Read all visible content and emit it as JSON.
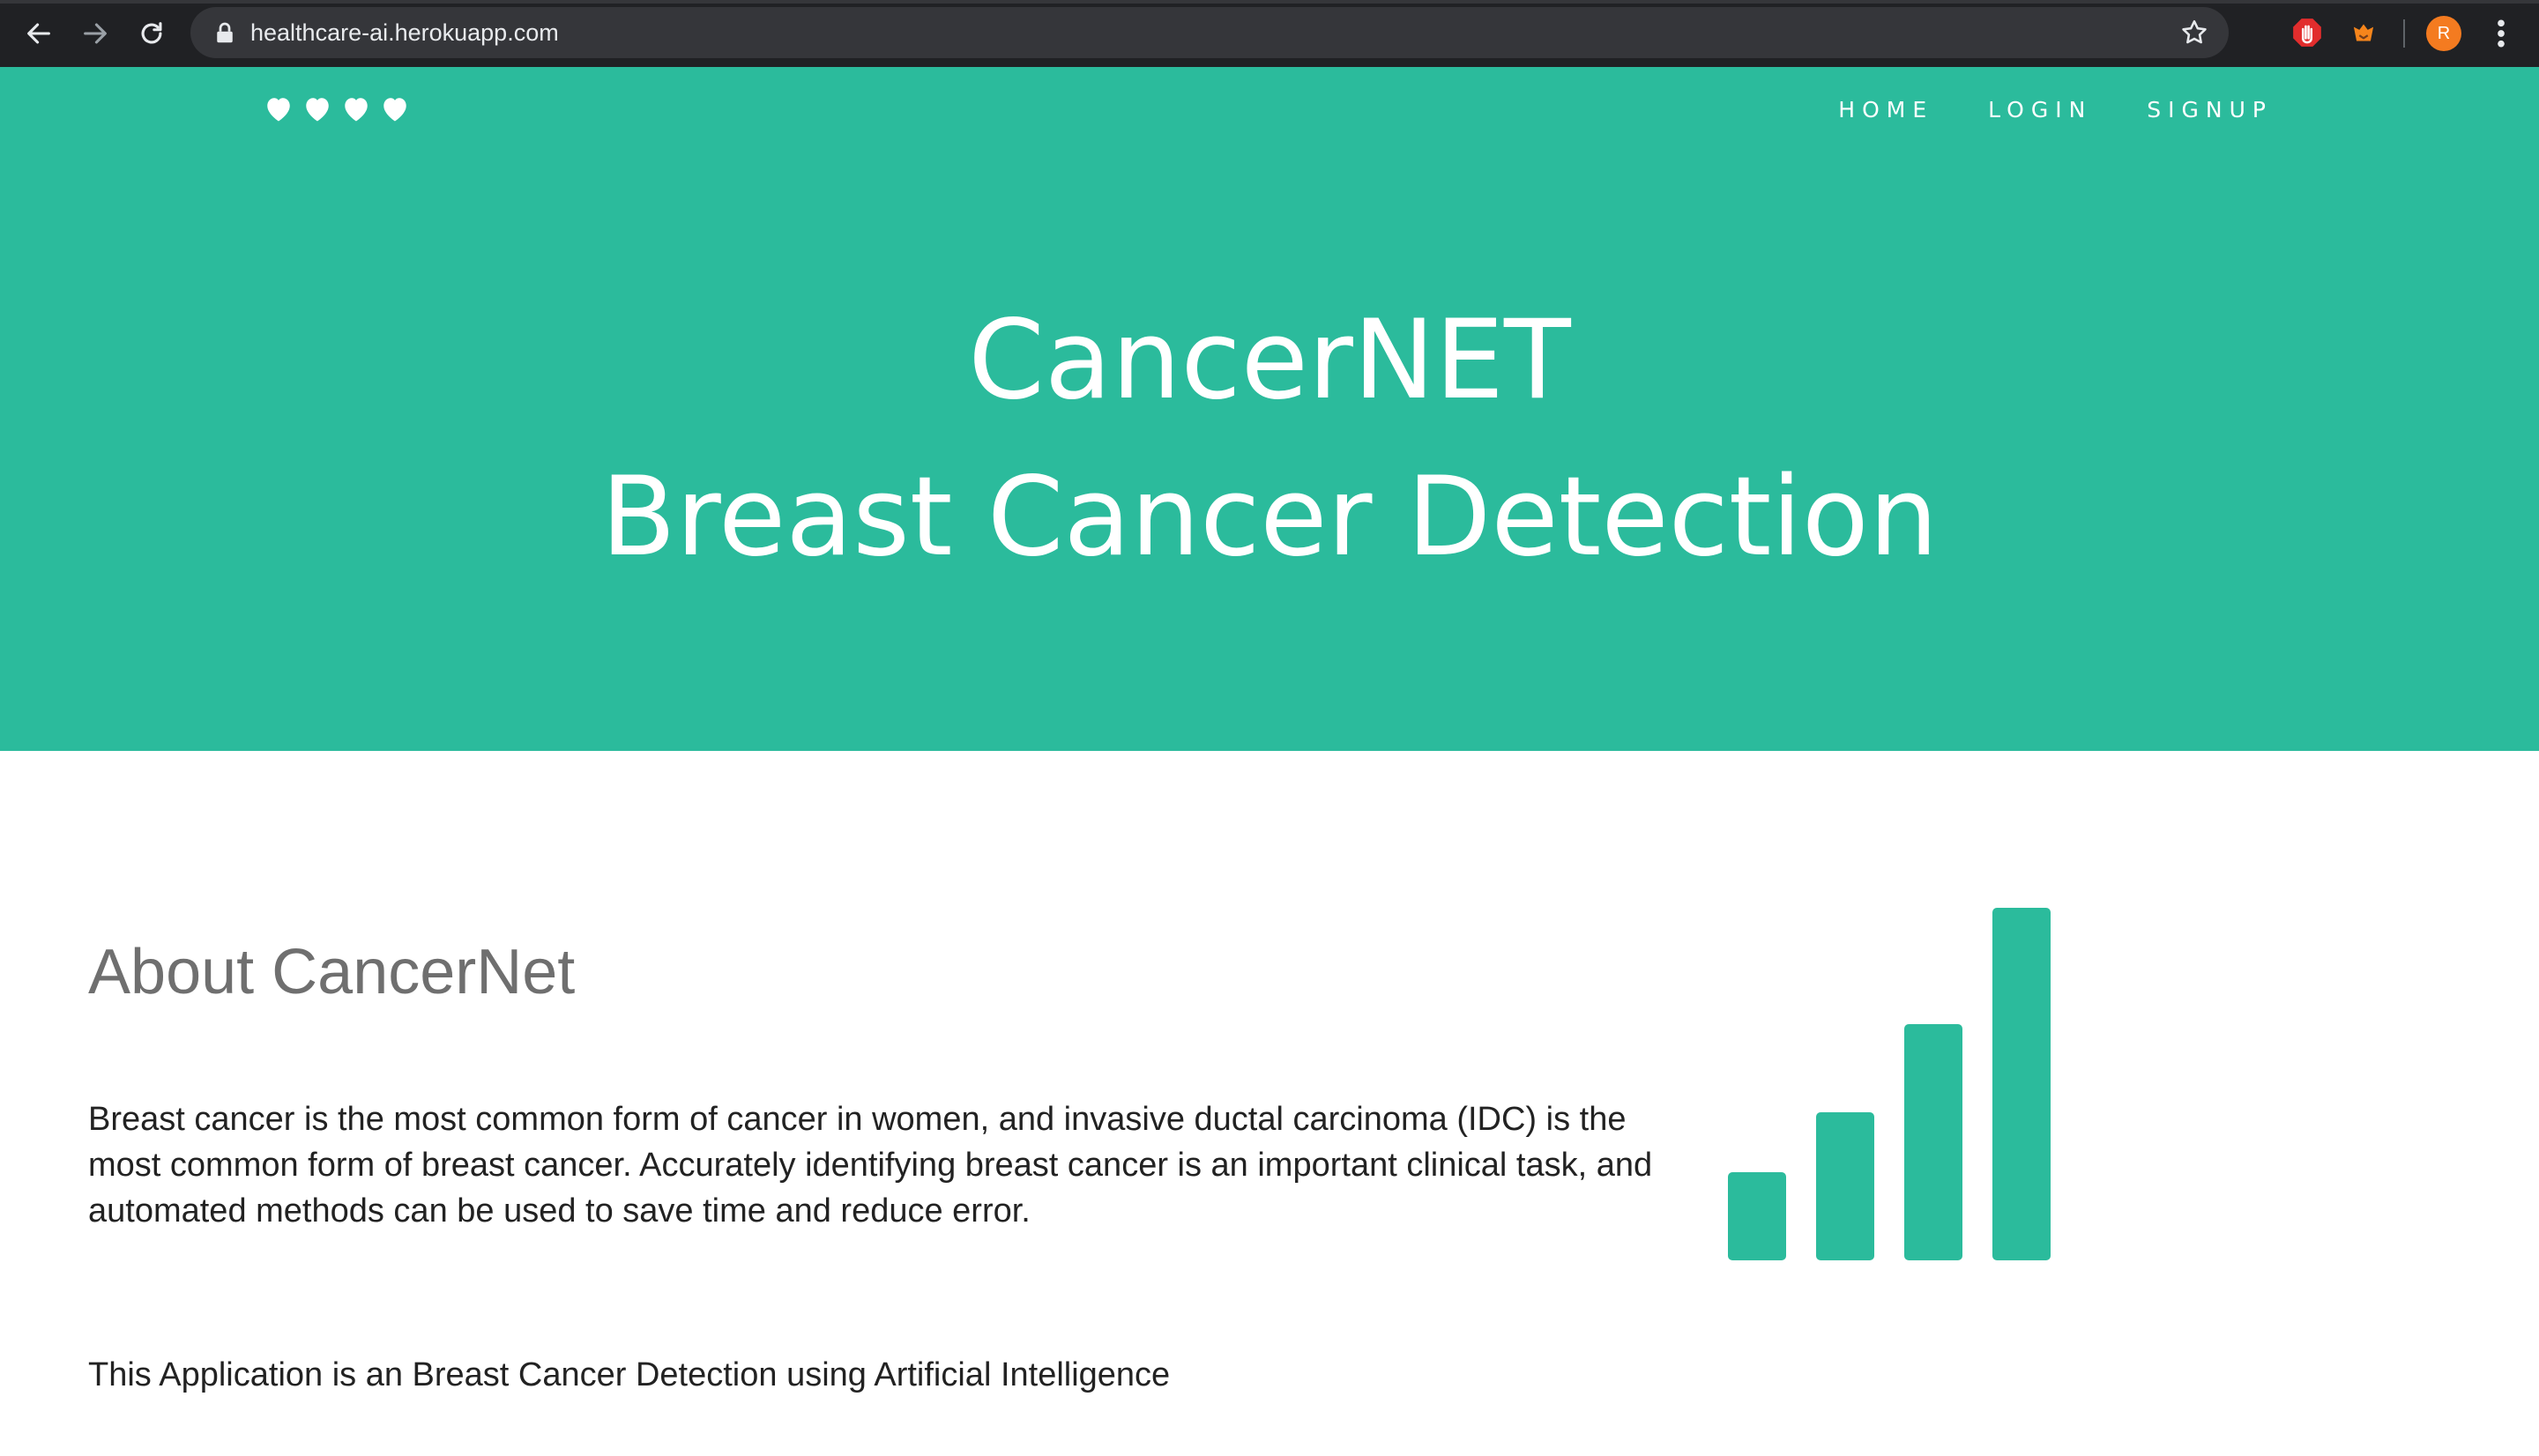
{
  "browser": {
    "url": "healthcare-ai.herokuapp.com",
    "avatar_letter": "R",
    "icons": [
      "back-icon",
      "forward-icon",
      "reload-icon",
      "lock-icon",
      "star-icon",
      "adblock-icon",
      "extension-fox-icon",
      "menu-dots-icon"
    ]
  },
  "site": {
    "brand_icons": [
      "heart-icon",
      "heart-icon",
      "heart-icon",
      "heart-icon"
    ],
    "nav": {
      "home": "HOME",
      "login": "LOGIN",
      "signup": "SIGNUP"
    },
    "hero": {
      "line1": "CancerNET",
      "line2": "Breast Cancer Detection"
    },
    "about": {
      "title": "About CancerNet",
      "paragraph": "Breast cancer is the most common form of cancer in women, and invasive ductal carcinoma (IDC) is the most common form of breast cancer. Accurately identifying breast cancer is an important clinical task, and automated methods can be used to save time and reduce error.",
      "tagline": "This Application is an Breast Cancer Detection using Artificial Intelligence"
    },
    "decor_icon": "bar-chart-icon"
  },
  "colors": {
    "brand": "#2bbb9c",
    "chrome": "#202124",
    "omnibox": "#35363a"
  }
}
